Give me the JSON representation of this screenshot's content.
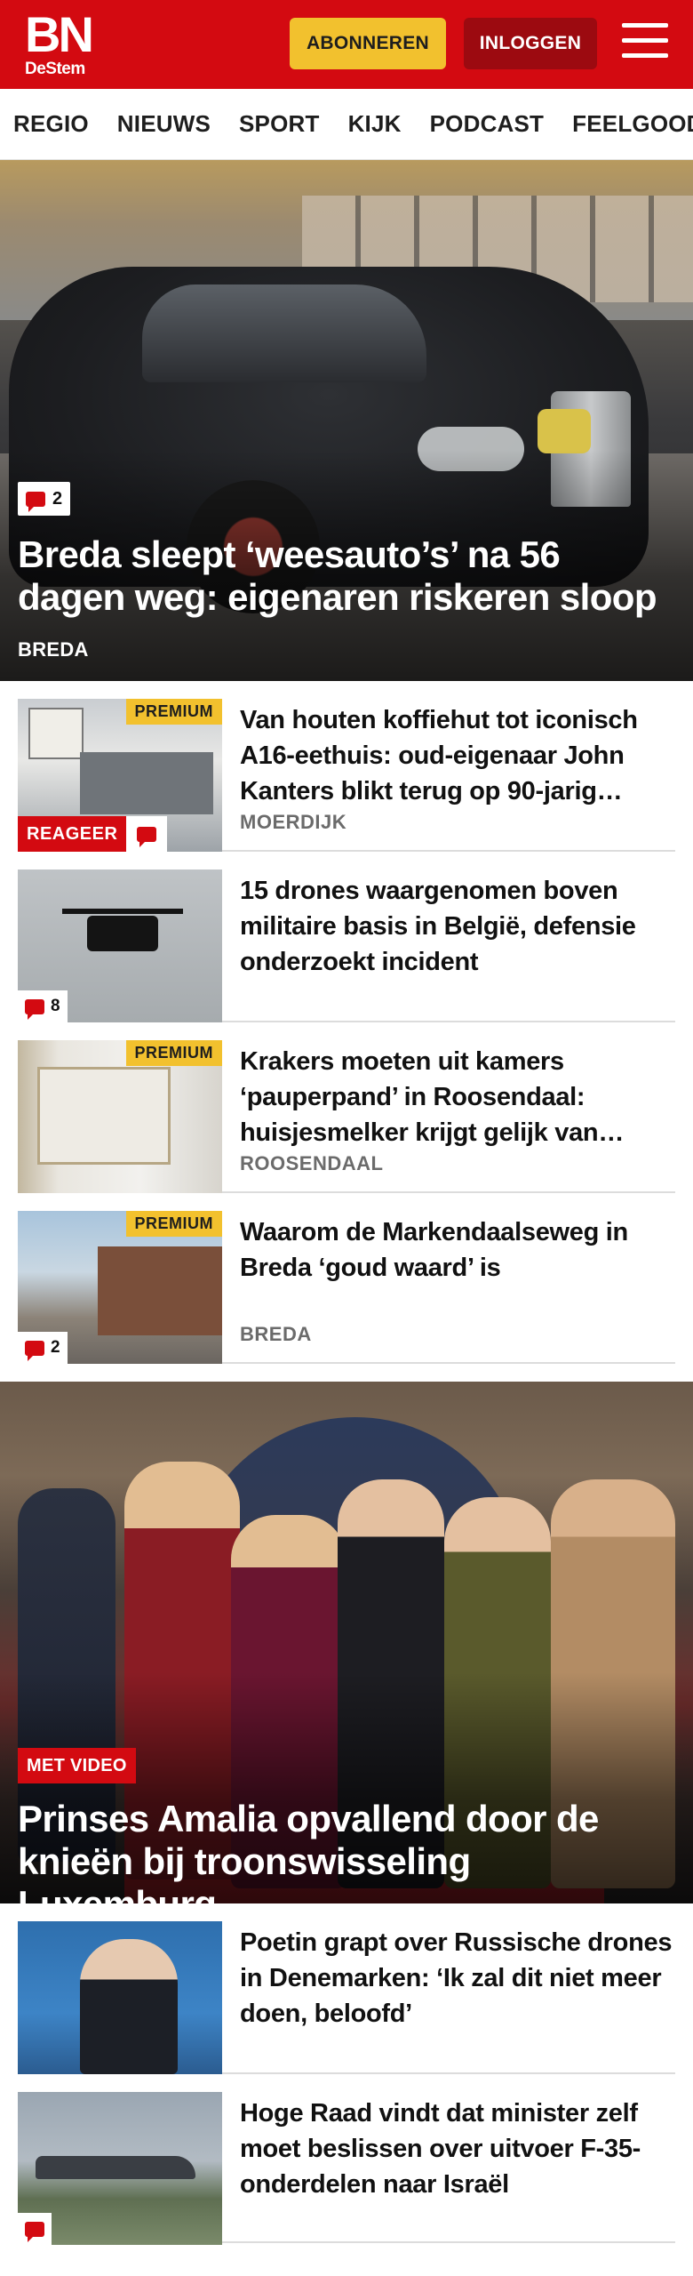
{
  "header": {
    "logo_main": "BN",
    "logo_sub": "DeStem",
    "subscribe_label": "ABONNEREN",
    "login_label": "INLOGGEN",
    "accent": "#d30a11",
    "subscribe_color": "#f2c12e",
    "login_color": "#9c0a10"
  },
  "nav": {
    "items": [
      "REGIO",
      "NIEUWS",
      "SPORT",
      "KIJK",
      "PODCAST",
      "FEELGOOD"
    ]
  },
  "hero1": {
    "comments": "2",
    "title": "Breda sleept ‘weesauto’s’ na 56 dagen weg: eigenaren riskeren sloop",
    "tag": "BREDA"
  },
  "articles": [
    {
      "title": "Van houten koffiehut tot iconisch A16-eethuis: oud-eigenaar John Kanters blikt terug op 90-jarig…",
      "tag": "MOERDIJK",
      "premium": "PREMIUM",
      "reageer": "REAGEER"
    },
    {
      "title": "15 drones waargenomen boven militaire basis in België, defensie onderzoekt incident",
      "comments": "8"
    },
    {
      "title": "Krakers moeten uit kamers ‘pauperpand’ in Roosendaal: huisjesmelker krijgt gelijk van…",
      "tag": "ROOSENDAAL",
      "premium": "PREMIUM"
    },
    {
      "title": "Waarom de Markendaalseweg in Breda ‘goud waard’ is",
      "tag": "BREDA",
      "premium": "PREMIUM",
      "comments": "2"
    }
  ],
  "hero2": {
    "badge": "MET VIDEO",
    "title": "Prinses Amalia opvallend door de knieën bij troonswisseling Luxemburg"
  },
  "articles2": [
    {
      "title": "Poetin grapt over Russische drones in Denemarken: ‘Ik zal dit niet meer doen, beloofd’"
    },
    {
      "title": "Hoge Raad vindt dat minister zelf moet beslissen over uitvoer F-35-onderdelen naar Israël"
    }
  ]
}
